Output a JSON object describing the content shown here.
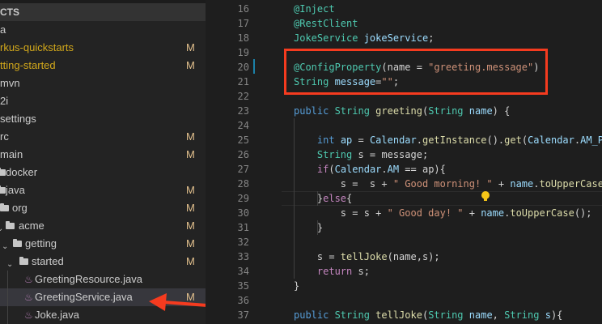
{
  "explorer": {
    "header": "CTS",
    "items": [
      {
        "label": "a",
        "modified": false,
        "badge": ""
      },
      {
        "label": "rkus-quickstarts",
        "modified": true,
        "badge": "M"
      },
      {
        "label": "tting-started",
        "modified": true,
        "badge": "M"
      },
      {
        "label": "mvn",
        "modified": false,
        "badge": ""
      },
      {
        "label": "2i",
        "modified": false,
        "badge": ""
      },
      {
        "label": "settings",
        "modified": false,
        "badge": ""
      },
      {
        "label": "rc",
        "modified": false,
        "badge": "M"
      },
      {
        "label": "main",
        "modified": false,
        "badge": "M"
      },
      {
        "label": "docker",
        "modified": false,
        "badge": ""
      },
      {
        "label": "java",
        "modified": false,
        "badge": "M"
      },
      {
        "label": "org",
        "modified": false,
        "badge": "M"
      },
      {
        "label": "acme",
        "modified": false,
        "badge": "M"
      },
      {
        "label": "getting",
        "modified": false,
        "badge": "M"
      },
      {
        "label": "started",
        "modified": false,
        "badge": "M"
      },
      {
        "label": "GreetingResource.java",
        "modified": false,
        "badge": ""
      },
      {
        "label": "GreetingService.java",
        "modified": false,
        "badge": "M",
        "selected": true
      },
      {
        "label": "Joke.java",
        "modified": false,
        "badge": ""
      }
    ]
  },
  "editor": {
    "lines": [
      {
        "n": "16",
        "tokens": [
          [
            "@Inject",
            "ty"
          ]
        ]
      },
      {
        "n": "17",
        "tokens": [
          [
            "@RestClient",
            "ty"
          ]
        ]
      },
      {
        "n": "18",
        "tokens": [
          [
            "JokeService ",
            "ty"
          ],
          [
            "jokeService",
            "v"
          ],
          [
            ";",
            "d"
          ]
        ]
      },
      {
        "n": "19",
        "tokens": []
      },
      {
        "n": "20",
        "tokens": [
          [
            "@ConfigProperty",
            "ty"
          ],
          [
            "(name = ",
            "d"
          ],
          [
            "\"greeting.message\"",
            "s"
          ],
          [
            ")",
            "d"
          ]
        ]
      },
      {
        "n": "21",
        "tokens": [
          [
            "String ",
            "ty"
          ],
          [
            "message",
            "v"
          ],
          [
            "=",
            "d"
          ],
          [
            "\"\"",
            "s"
          ],
          [
            ";",
            "d"
          ]
        ]
      },
      {
        "n": "22",
        "tokens": []
      },
      {
        "n": "23",
        "tokens": [
          [
            "public ",
            "kw"
          ],
          [
            "String ",
            "ty"
          ],
          [
            "greeting",
            "fn"
          ],
          [
            "(",
            "d"
          ],
          [
            "String ",
            "ty"
          ],
          [
            "name",
            "v"
          ],
          [
            ") {",
            "d"
          ]
        ]
      },
      {
        "n": "24",
        "tokens": []
      },
      {
        "n": "25",
        "tokens": [
          [
            "    ",
            "d"
          ],
          [
            "int ",
            "kw"
          ],
          [
            "ap",
            "v"
          ],
          [
            " = ",
            "d"
          ],
          [
            "Calendar",
            "v"
          ],
          [
            ".",
            "d"
          ],
          [
            "getInstance",
            "fn"
          ],
          [
            "().",
            "d"
          ],
          [
            "get",
            "fn"
          ],
          [
            "(",
            "d"
          ],
          [
            "Calendar",
            "v"
          ],
          [
            ".",
            "d"
          ],
          [
            "AM_PM",
            "v"
          ],
          [
            ");",
            "d"
          ]
        ]
      },
      {
        "n": "26",
        "tokens": [
          [
            "    ",
            "d"
          ],
          [
            "String ",
            "ty"
          ],
          [
            "s = message;",
            "d"
          ]
        ]
      },
      {
        "n": "27",
        "tokens": [
          [
            "    ",
            "d"
          ],
          [
            "if",
            "ct"
          ],
          [
            "(",
            "d"
          ],
          [
            "Calendar",
            "v"
          ],
          [
            ".",
            "d"
          ],
          [
            "AM",
            "v"
          ],
          [
            " == ap){",
            "d"
          ]
        ]
      },
      {
        "n": "28",
        "tokens": [
          [
            "        s =  s + ",
            "d"
          ],
          [
            "\" Good morning! \"",
            "s"
          ],
          [
            " + ",
            "d"
          ],
          [
            "name",
            "v"
          ],
          [
            ".",
            "d"
          ],
          [
            "toUpperCase",
            "fn"
          ],
          [
            "();",
            "d"
          ]
        ]
      },
      {
        "n": "29",
        "tokens": [
          [
            "    }",
            "d"
          ],
          [
            "else",
            "ct"
          ],
          [
            "{",
            "d"
          ]
        ]
      },
      {
        "n": "30",
        "tokens": [
          [
            "        s = s + ",
            "d"
          ],
          [
            "\" Good day! \"",
            "s"
          ],
          [
            " + ",
            "d"
          ],
          [
            "name",
            "v"
          ],
          [
            ".",
            "d"
          ],
          [
            "toUpperCase",
            "fn"
          ],
          [
            "();",
            "d"
          ]
        ]
      },
      {
        "n": "31",
        "tokens": [
          [
            "    }",
            "d"
          ]
        ]
      },
      {
        "n": "32",
        "tokens": []
      },
      {
        "n": "33",
        "tokens": [
          [
            "    s = ",
            "d"
          ],
          [
            "tellJoke",
            "fn"
          ],
          [
            "(name,s);",
            "d"
          ]
        ]
      },
      {
        "n": "34",
        "tokens": [
          [
            "    ",
            "d"
          ],
          [
            "return ",
            "ct"
          ],
          [
            "s;",
            "d"
          ]
        ]
      },
      {
        "n": "35",
        "tokens": [
          [
            "}",
            "d"
          ]
        ]
      },
      {
        "n": "36",
        "tokens": []
      },
      {
        "n": "37",
        "tokens": [
          [
            "public ",
            "kw"
          ],
          [
            "String ",
            "ty"
          ],
          [
            "tellJoke",
            "fn"
          ],
          [
            "(",
            "d"
          ],
          [
            "String ",
            "ty"
          ],
          [
            "name",
            "v"
          ],
          [
            ", ",
            "d"
          ],
          [
            "String ",
            "ty"
          ],
          [
            "s",
            "v"
          ],
          [
            "){",
            "d"
          ]
        ]
      }
    ]
  },
  "colors": {
    "annotation_box": "#f53b1f",
    "arrow": "#f53b1f",
    "modified": "#d2a81b",
    "badge": "#e2c08d"
  }
}
